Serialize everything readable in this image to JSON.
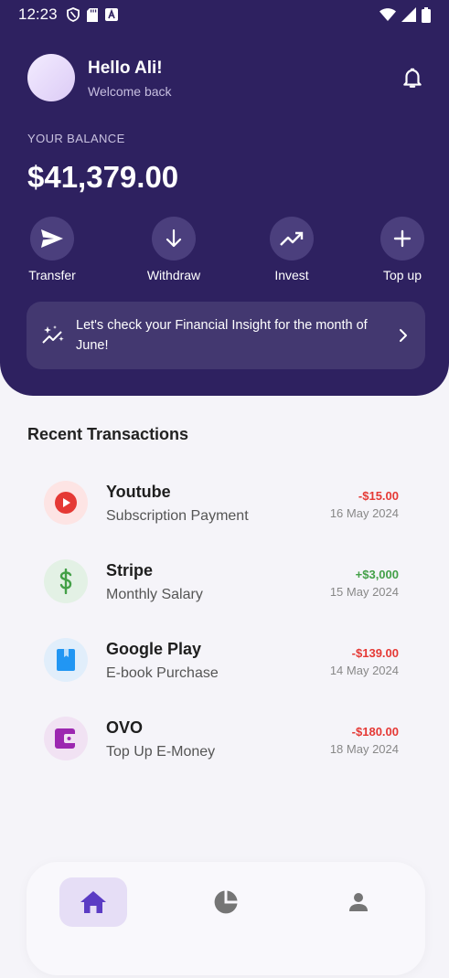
{
  "status_bar": {
    "time": "12:23",
    "icons_left": [
      "shield-icon",
      "sd-card-icon",
      "font-a-icon"
    ],
    "icons_right": [
      "wifi-icon",
      "signal-icon",
      "battery-icon"
    ]
  },
  "header": {
    "greeting": "Hello Ali!",
    "subtitle": "Welcome back",
    "balance_label": "YOUR BALANCE",
    "balance_value": "$41,379.00",
    "bg_color": "#2e2160"
  },
  "actions": [
    {
      "label": "Transfer",
      "icon": "send-icon"
    },
    {
      "label": "Withdraw",
      "icon": "arrow-down-icon"
    },
    {
      "label": "Invest",
      "icon": "trending-up-icon"
    },
    {
      "label": "Top up",
      "icon": "plus-icon"
    }
  ],
  "insight": {
    "text": "Let's check your Financial Insight for the month of June!",
    "icon": "sparkle-chart-icon"
  },
  "transactions_title": "Recent Transactions",
  "transactions": [
    {
      "name": "Youtube",
      "desc": "Subscription Payment",
      "amount": "-$15.00",
      "date": "16 May 2024",
      "icon": "youtube-icon",
      "amount_color": "#e53935"
    },
    {
      "name": "Stripe",
      "desc": "Monthly Salary",
      "amount": "+$3,000",
      "date": "15 May 2024",
      "icon": "dollar-icon",
      "amount_color": "#43a047"
    },
    {
      "name": "Google Play",
      "desc": "E-book Purchase",
      "amount": "-$139.00",
      "date": "14 May 2024",
      "icon": "book-icon",
      "amount_color": "#e53935"
    },
    {
      "name": "OVO",
      "desc": "Top Up E-Money",
      "amount": "-$180.00",
      "date": "18 May 2024",
      "icon": "wallet-icon",
      "amount_color": "#e53935"
    }
  ],
  "nav": {
    "items": [
      "home-icon",
      "pie-chart-icon",
      "person-icon"
    ],
    "active": "home-icon",
    "accent": "#5b3cc4"
  }
}
